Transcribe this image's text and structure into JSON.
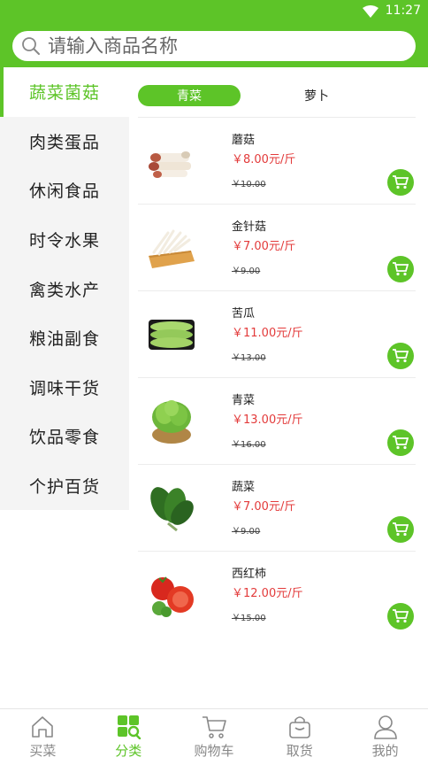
{
  "status_bar": {
    "time": "11:27"
  },
  "search": {
    "placeholder": "请输入商品名称"
  },
  "categories": [
    {
      "label": "蔬菜菌菇",
      "active": true
    },
    {
      "label": "肉类蛋品"
    },
    {
      "label": "休闲食品"
    },
    {
      "label": "时令水果"
    },
    {
      "label": "禽类水产"
    },
    {
      "label": "粮油副食"
    },
    {
      "label": "调味干货"
    },
    {
      "label": "饮品零食"
    },
    {
      "label": "个护百货"
    }
  ],
  "subtabs": [
    {
      "label": "青菜",
      "active": true
    },
    {
      "label": "萝卜"
    }
  ],
  "products": [
    {
      "name": "蘑菇",
      "price": "￥8.00元/斤",
      "old_price": "￥10.00",
      "image": "mushroom"
    },
    {
      "name": "金针菇",
      "price": "￥7.00元/斤",
      "old_price": "￥9.00",
      "image": "enoki"
    },
    {
      "name": "苦瓜",
      "price": "￥11.00元/斤",
      "old_price": "￥13.00",
      "image": "bitter-melon"
    },
    {
      "name": "青菜",
      "price": "￥13.00元/斤",
      "old_price": "￥16.00",
      "image": "lettuce"
    },
    {
      "name": "蔬菜",
      "price": "￥7.00元/斤",
      "old_price": "￥9.00",
      "image": "spinach"
    },
    {
      "name": "西红柿",
      "price": "￥12.00元/斤",
      "old_price": "￥15.00",
      "image": "tomato"
    }
  ],
  "bottom_nav": [
    {
      "label": "买菜",
      "icon": "home-icon"
    },
    {
      "label": "分类",
      "icon": "category-icon",
      "active": true
    },
    {
      "label": "购物车",
      "icon": "cart-icon"
    },
    {
      "label": "取货",
      "icon": "bag-icon"
    },
    {
      "label": "我的",
      "icon": "user-icon"
    }
  ],
  "colors": {
    "brand": "#5dc428",
    "price": "#e33b3b"
  }
}
